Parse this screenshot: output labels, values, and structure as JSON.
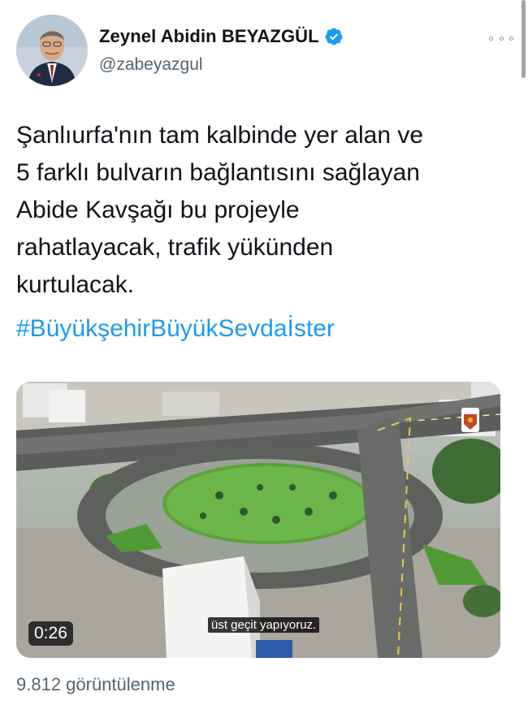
{
  "tweet": {
    "author_name": "Zeynel Abidin BEYAZGÜL",
    "author_handle": "@zabeyazgul",
    "verified_icon": "verified-badge-icon",
    "text": "Şanlıurfa'nın tam kalbinde yer alan ve\n5 farklı bulvarın bağlantısını sağlayan\nAbide Kavşağı bu projeyle\nrahatlayacak, trafik yükünden\nkurtulacak.",
    "hashtag": "#BüyükşehirBüyükSevdaİster"
  },
  "video": {
    "duration": "0:26",
    "subtitle": "üst geçit yapıyoruz."
  },
  "footer": {
    "views": "9.812 görüntülenme"
  },
  "colors": {
    "accent": "#1d9bf0",
    "secondary_text": "#536471",
    "primary_text": "#0f1419"
  }
}
